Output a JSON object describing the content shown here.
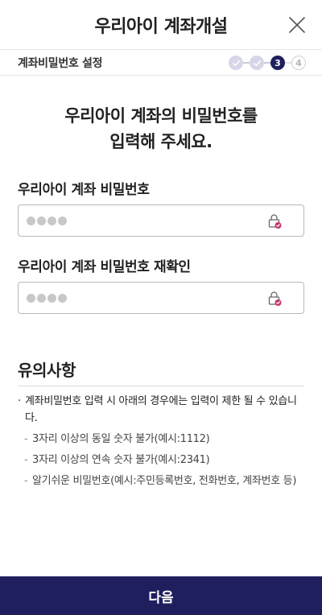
{
  "header": {
    "title": "우리아이 계좌개설",
    "close_icon": "close-icon"
  },
  "stepbar": {
    "label": "계좌비밀번호 설정",
    "steps": [
      {
        "state": "done",
        "label": ""
      },
      {
        "state": "done",
        "label": ""
      },
      {
        "state": "current",
        "label": "3"
      },
      {
        "state": "upcoming",
        "label": "4"
      }
    ]
  },
  "headline": {
    "line1": "우리아이 계좌의 비밀번호를",
    "line2": "입력해 주세요."
  },
  "fields": [
    {
      "label": "우리아이 계좌 비밀번호",
      "masked_length": 4,
      "icon": "secure-keypad-lock-icon"
    },
    {
      "label": "우리아이 계좌 비밀번호 재확인",
      "masked_length": 4,
      "icon": "secure-keypad-lock-icon"
    }
  ],
  "notice": {
    "title": "유의사항",
    "main": "계좌비밀번호 입력 시 아래의 경우에는 입력이 제한 될 수 있습니다.",
    "items": [
      "3자리 이상의 동일 숫자 불가(예시:1112)",
      "3자리 이상의 연속 숫자 불가(예시:2341)",
      "알기쉬운 비밀번호(예시:주민등록번호, 전화번호, 계좌번호 등)"
    ]
  },
  "footer": {
    "next_label": "다음"
  },
  "colors": {
    "primary": "#1f1f5e",
    "step_done": "#d6d6e8",
    "lock_accent": "#c2366f",
    "mask_dot": "#c8c8c8"
  }
}
